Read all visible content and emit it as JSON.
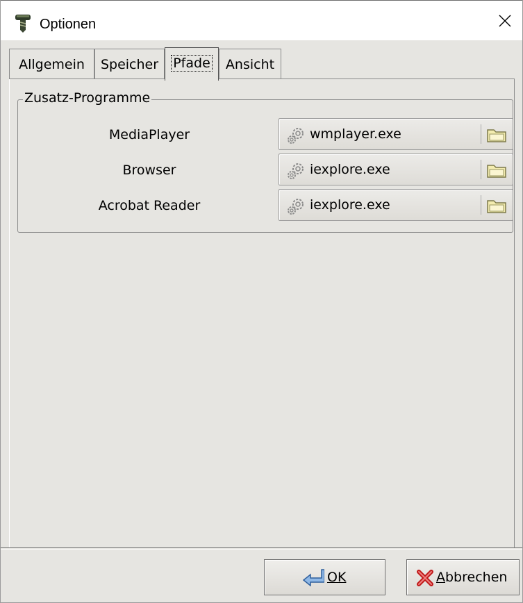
{
  "window": {
    "title": "Optionen"
  },
  "tabs": [
    {
      "label": "Allgemein"
    },
    {
      "label": "Speicher"
    },
    {
      "label": "Pfade"
    },
    {
      "label": "Ansicht"
    }
  ],
  "active_tab": "Pfade",
  "group": {
    "title": "Zusatz-Programme",
    "rows": [
      {
        "label": "MediaPlayer",
        "value": "wmplayer.exe"
      },
      {
        "label": "Browser",
        "value": "iexplore.exe"
      },
      {
        "label": "Acrobat Reader",
        "value": "iexplore.exe"
      }
    ]
  },
  "buttons": {
    "ok_label": "OK",
    "cancel_label": "Abbrechen"
  },
  "icons": {
    "app": "screw-icon",
    "close": "close-icon",
    "gear": "gear-icon",
    "folder": "folder-icon",
    "ok": "return-arrow-icon",
    "cancel": "red-x-icon"
  }
}
